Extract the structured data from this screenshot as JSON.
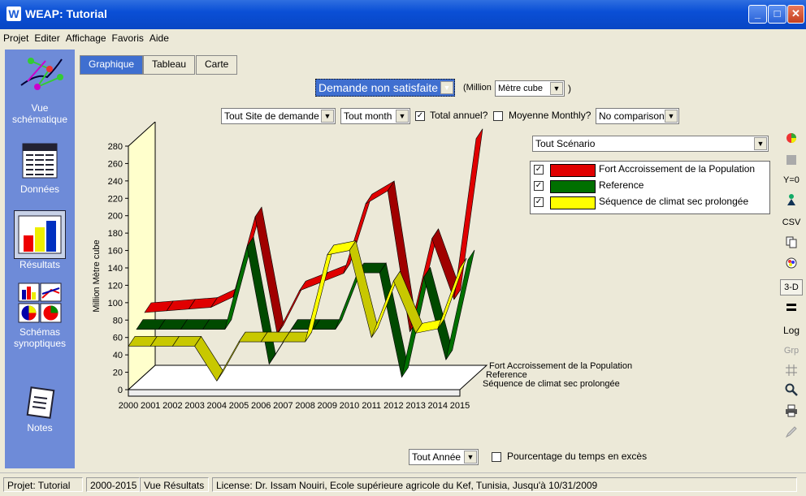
{
  "window": {
    "icon_letter": "W",
    "title": "WEAP: Tutorial"
  },
  "menu": [
    "Projet",
    "Editer",
    "Affichage",
    "Favoris",
    "Aide"
  ],
  "sidebar": [
    {
      "label_lines": [
        "Vue",
        "schématique"
      ]
    },
    {
      "label_lines": [
        "Données"
      ]
    },
    {
      "label_lines": [
        "Résultats"
      ]
    },
    {
      "label_lines": [
        "Schémas",
        "synoptiques"
      ]
    },
    {
      "label_lines": [
        "Notes"
      ]
    }
  ],
  "tabs": [
    "Graphique",
    "Tableau",
    "Carte"
  ],
  "controls": {
    "variable": "Demande non satisfaite",
    "unit_prefix": "(Million",
    "unit": "Mètre cube",
    "unit_suffix": ")",
    "site": "Tout Site de demande",
    "month": "Tout month",
    "total_annual_label": "Total annuel?",
    "total_annual_checked": true,
    "monthly_avg_label": "Moyenne Monthly?",
    "monthly_avg_checked": false,
    "comparison": "No comparison",
    "scenario": "Tout Scénario",
    "year": "Tout Année",
    "exceed_label": "Pourcentage du temps en excès",
    "exceed_checked": false
  },
  "right_tools": [
    "Y=0",
    "CSV",
    "3-D",
    "Log",
    "Grp"
  ],
  "right_tool_icons": [
    "color-icon",
    "square-icon",
    "y-zero",
    "person-icon",
    "csv",
    "copy-icon",
    "palette-icon",
    "3d",
    "lines-icon",
    "log",
    "grp",
    "grid-icon",
    "zoom-icon",
    "print-icon",
    "edit-icon"
  ],
  "chart_data": {
    "type": "line",
    "style": "3d-ribbon",
    "ylabel": "Million Mètre cube",
    "ylim": [
      0,
      280
    ],
    "yticks": [
      0,
      20,
      40,
      60,
      80,
      100,
      120,
      140,
      160,
      180,
      200,
      220,
      240,
      260,
      280
    ],
    "x": [
      "2000",
      "2001",
      "2002",
      "2003",
      "2004",
      "2005",
      "2006",
      "2007",
      "2008",
      "2009",
      "2010",
      "2011",
      "2012",
      "2013",
      "2014",
      "2015"
    ],
    "series": [
      {
        "name": "Fort Accroissement de la Population",
        "color": "#e00000",
        "values": [
          70,
          72,
          74,
          76,
          88,
          180,
          45,
          95,
          105,
          115,
          195,
          210,
          48,
          155,
          85,
          270
        ]
      },
      {
        "name": "Reference",
        "color": "#007000",
        "values": [
          60,
          60,
          60,
          60,
          60,
          155,
          20,
          60,
          60,
          60,
          125,
          125,
          5,
          120,
          25,
          140
        ]
      },
      {
        "name": "Séquence de climat sec prolongée",
        "color": "#ffff00",
        "values": [
          50,
          50,
          50,
          50,
          10,
          55,
          55,
          55,
          55,
          155,
          160,
          60,
          125,
          65,
          70,
          140
        ]
      }
    ],
    "depth_labels": [
      "Fort Accroissement de la Population",
      "Reference",
      "Séquence de climat sec prolongée"
    ]
  },
  "status": [
    "Projet: Tutorial",
    "2000-2015",
    "Vue Résultats",
    "License: Dr. Issam Nouiri, Ecole supérieure agricole du Kef, Tunisia, Jusqu'à 10/31/2009"
  ]
}
